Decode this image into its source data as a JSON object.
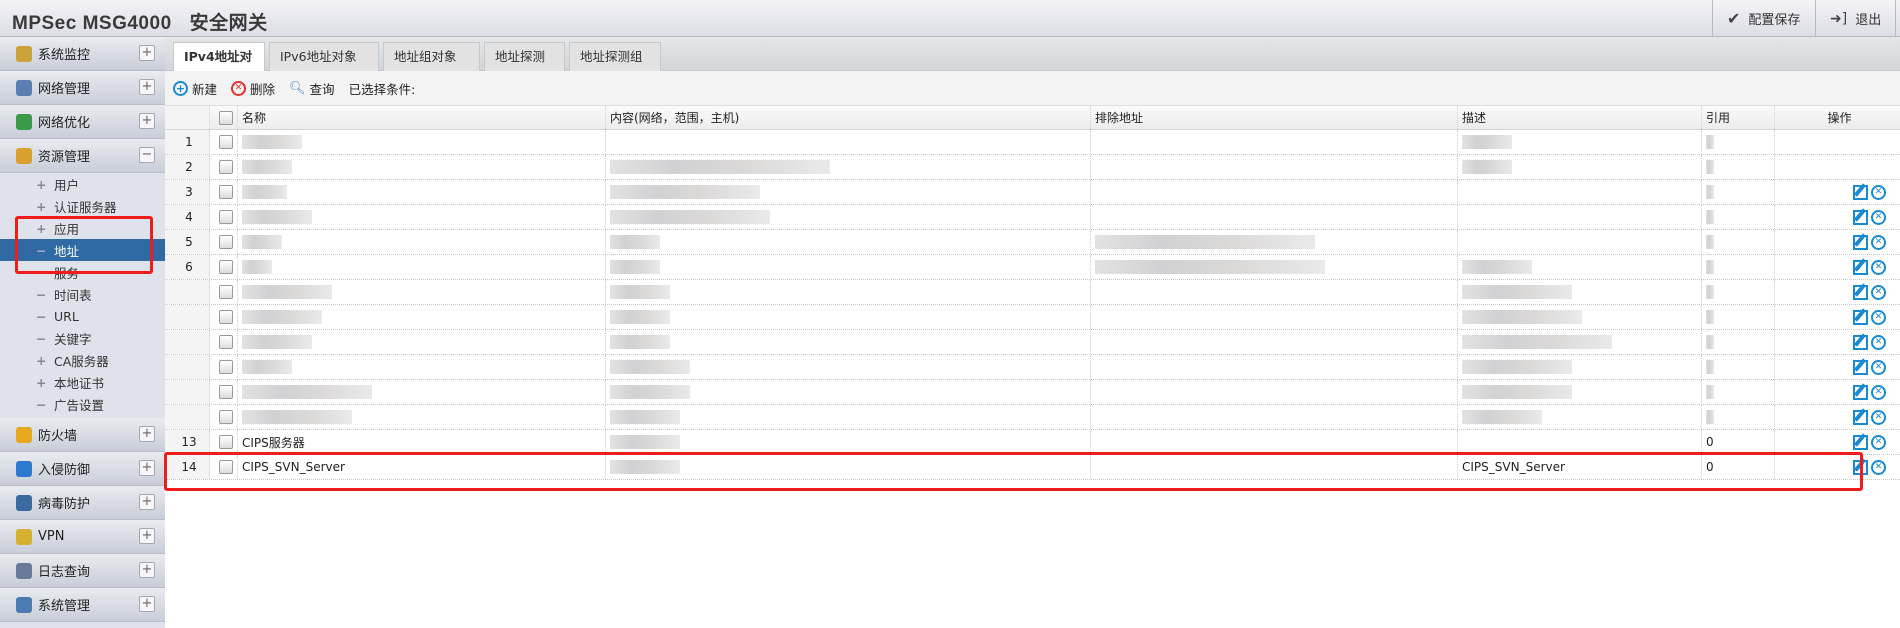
{
  "header": {
    "product": "MPSec MSG4000",
    "title": "安全网关",
    "save_label": "配置保存",
    "logout_label": "退出"
  },
  "sidebar": {
    "sections_top": [
      {
        "label": "系统监控",
        "toggle": "+",
        "color": "#c9a23a"
      },
      {
        "label": "网络管理",
        "toggle": "+",
        "color": "#5a7fb0"
      },
      {
        "label": "网络优化",
        "toggle": "+",
        "color": "#3a9a4a"
      },
      {
        "label": "资源管理",
        "toggle": "−",
        "color": "#d9a030"
      }
    ],
    "sub_items": [
      {
        "label": "用户",
        "mark": "+"
      },
      {
        "label": "认证服务器",
        "mark": "+"
      },
      {
        "label": "应用",
        "mark": "+"
      },
      {
        "label": "地址",
        "mark": "−",
        "selected": true
      },
      {
        "label": "服务",
        "mark": "−"
      },
      {
        "label": "时间表",
        "mark": "−"
      },
      {
        "label": "URL",
        "mark": "−"
      },
      {
        "label": "关键字",
        "mark": "−"
      },
      {
        "label": "CA服务器",
        "mark": "+"
      },
      {
        "label": "本地证书",
        "mark": "+"
      },
      {
        "label": "广告设置",
        "mark": "−"
      }
    ],
    "sections_bottom": [
      {
        "label": "防火墙",
        "toggle": "+",
        "color": "#e8a820"
      },
      {
        "label": "入侵防御",
        "toggle": "+",
        "color": "#2a7ad0"
      },
      {
        "label": "病毒防护",
        "toggle": "+",
        "color": "#3a6aa0"
      },
      {
        "label": "VPN",
        "toggle": "+",
        "color": "#d8b030"
      },
      {
        "label": "日志查询",
        "toggle": "+",
        "color": "#6a7a9a"
      },
      {
        "label": "系统管理",
        "toggle": "+",
        "color": "#4a7ab0"
      }
    ]
  },
  "tabs": [
    "IPv4地址对象",
    "IPv6地址对象",
    "地址组对象",
    "地址探测",
    "地址探测组"
  ],
  "toolbar": {
    "new_label": "新建",
    "delete_label": "删除",
    "query_label": "查询",
    "selected_conditions": "已选择条件:"
  },
  "table": {
    "columns": [
      "名称",
      "内容(网络，范围，主机)",
      "排除地址",
      "描述",
      "引用",
      "操作"
    ],
    "rows": [
      {
        "num": "1",
        "name": "",
        "desc": "",
        "ref": "",
        "actions": false
      },
      {
        "num": "2",
        "name": "",
        "desc": "",
        "ref": "",
        "actions": false
      },
      {
        "num": "3",
        "name": "",
        "desc": "",
        "ref": "",
        "actions": true
      },
      {
        "num": "4",
        "name": "",
        "desc": "",
        "ref": "",
        "actions": true
      },
      {
        "num": "5",
        "name": "",
        "desc": "",
        "ref": "",
        "actions": true
      },
      {
        "num": "6",
        "name": "",
        "desc": "",
        "ref": "",
        "actions": true
      },
      {
        "num": "",
        "name": "",
        "desc": "",
        "ref": "",
        "actions": true
      },
      {
        "num": "",
        "name": "",
        "desc": "",
        "ref": "",
        "actions": true
      },
      {
        "num": "",
        "name": "",
        "desc": "",
        "ref": "",
        "actions": true
      },
      {
        "num": "",
        "name": "",
        "desc": "",
        "ref": "",
        "actions": true
      },
      {
        "num": "",
        "name": "",
        "desc": "",
        "ref": "",
        "actions": true
      },
      {
        "num": "",
        "name": "",
        "desc": "",
        "ref": "",
        "actions": true
      },
      {
        "num": "13",
        "name": "CIPS服务器",
        "desc": "",
        "ref": "0",
        "actions": true
      },
      {
        "num": "14",
        "name": "CIPS_SVN_Server",
        "desc": "CIPS_SVN_Server",
        "ref": "0",
        "actions": true
      }
    ]
  },
  "colors": {
    "accent": "#2f6aa5",
    "highlight": "#f01c1c",
    "icon_blue": "#1a8ad0"
  }
}
